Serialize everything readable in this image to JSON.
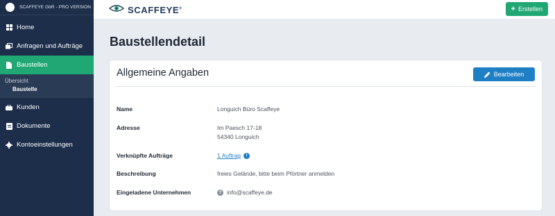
{
  "sidebar": {
    "company": "SCAFFEYE GbR - PRO VERSION",
    "items": [
      {
        "label": "Home",
        "icon": "grid-icon"
      },
      {
        "label": "Anfragen und Aufträge",
        "icon": "copy-icon"
      },
      {
        "label": "Baustellen",
        "icon": "file-icon"
      },
      {
        "label": "Kunden",
        "icon": "briefcase-icon"
      },
      {
        "label": "Dokumente",
        "icon": "document-icon"
      },
      {
        "label": "Kontoeinstellungen",
        "icon": "gear-icon"
      }
    ],
    "sub_label": "Übersicht",
    "sub_item": "Baustelle"
  },
  "topbar": {
    "logo": "SCAFFEYE",
    "logo_mark": "®",
    "create_label": "Erstellen"
  },
  "page": {
    "title": "Baustellendetail"
  },
  "card": {
    "title": "Allgemeine Angaben",
    "edit_label": "Bearbeiten",
    "fields": {
      "name_label": "Name",
      "name_value": "Longuich Büro Scaffeye",
      "address_label": "Adresse",
      "address_line1": "Im Paesch 17-18",
      "address_line2": "54340 Longuich",
      "orders_label": "Verknüpfte Aufträge",
      "orders_value": "1 Auftrag",
      "description_label": "Beschreibung",
      "description_value": "freies Gelände, bitte beim Pförtner anmelden",
      "invited_label": "Eingeladene Unternehmen",
      "invited_value": "info@scaffeye.de"
    }
  },
  "colors": {
    "sidebar_bg": "#1c2e4a",
    "accent_green": "#20a774",
    "accent_blue": "#1f7fc4",
    "page_bg": "#e8ebef"
  }
}
